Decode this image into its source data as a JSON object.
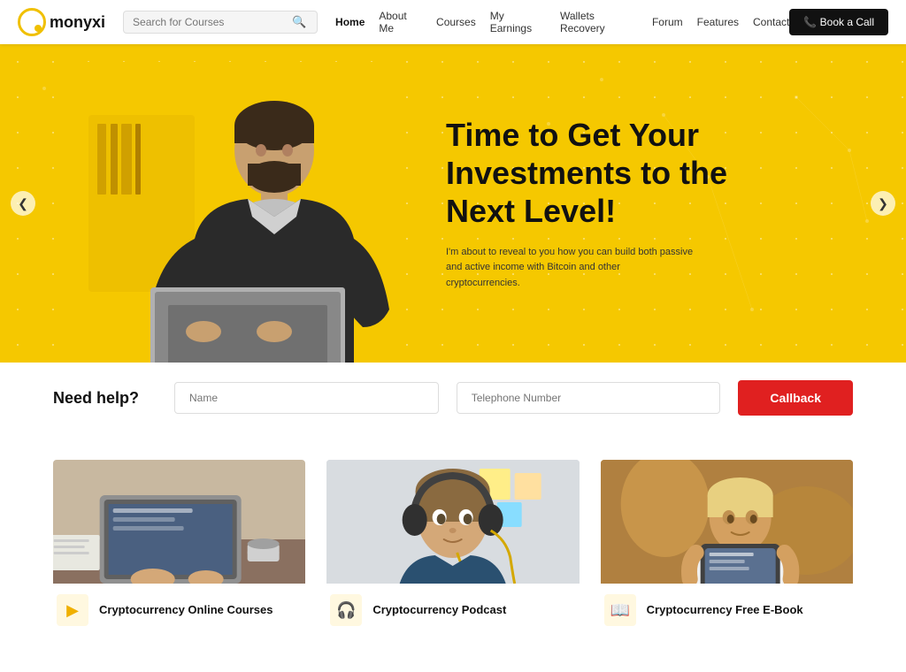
{
  "logo": {
    "text": "monyxi"
  },
  "search": {
    "placeholder": "Search for Courses"
  },
  "nav": {
    "links": [
      {
        "label": "Home",
        "active": true
      },
      {
        "label": "About Me",
        "active": false
      },
      {
        "label": "Courses",
        "active": false
      },
      {
        "label": "My Earnings",
        "active": false
      },
      {
        "label": "Wallets Recovery",
        "active": false
      },
      {
        "label": "Forum",
        "active": false
      },
      {
        "label": "Features",
        "active": false
      },
      {
        "label": "Contact",
        "active": false
      }
    ],
    "book_call": "📞 Book a Call"
  },
  "hero": {
    "title": "Time to Get Your Investments to the Next Level!",
    "subtitle": "I'm about to reveal to you how you can build both passive and active income with Bitcoin and other cryptocurrencies.",
    "arrow_left": "❮",
    "arrow_right": "❯"
  },
  "callback": {
    "label": "Need help?",
    "name_placeholder": "Name",
    "phone_placeholder": "Telephone Number",
    "button": "Callback"
  },
  "courses": [
    {
      "icon": "▶",
      "title": "Cryptocurrency Online Courses",
      "img_alt": "Person typing on laptop with coffee"
    },
    {
      "icon": "🎧",
      "title": "Cryptocurrency Podcast",
      "img_alt": "Woman with headphones"
    },
    {
      "icon": "📖",
      "title": "Cryptocurrency Free E-Book",
      "img_alt": "Woman reading tablet"
    }
  ]
}
